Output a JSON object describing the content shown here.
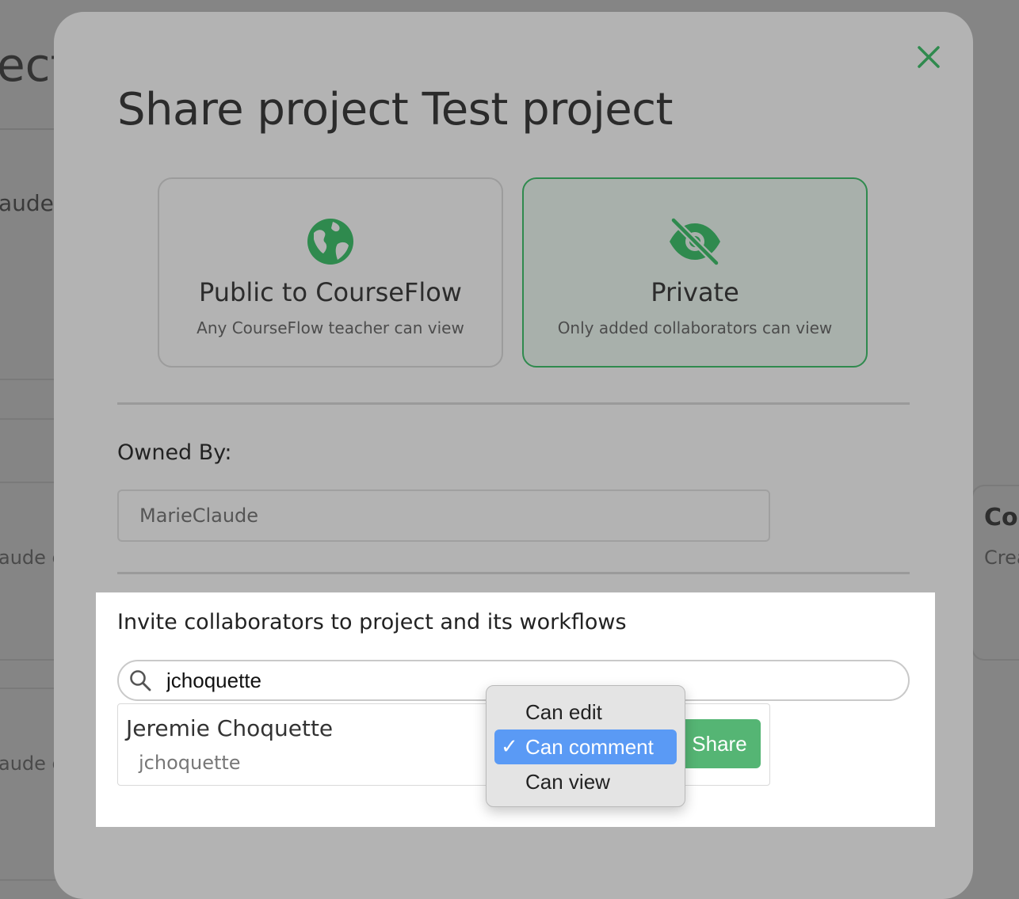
{
  "background": {
    "title_fragment": "ect",
    "name_fragment": "aude",
    "desc_fragment_1": "aude c",
    "desc_fragment_2": "aude c",
    "right_card_title": "Cou",
    "right_card_sub": "Crea"
  },
  "modal": {
    "title": "Share project Test project",
    "close_icon": "close-icon",
    "options": {
      "public": {
        "icon": "globe-icon",
        "title": "Public to CourseFlow",
        "subtitle": "Any CourseFlow teacher can view",
        "selected": false
      },
      "private": {
        "icon": "eye-slash-icon",
        "title": "Private",
        "subtitle": "Only added collaborators can view",
        "selected": true
      }
    },
    "owned_by_label": "Owned By:",
    "owner_value": "MarieClaude",
    "invite_heading": "Invite collaborators to project and its workflows",
    "search": {
      "icon": "search-icon",
      "value": "jchoquette"
    },
    "result": {
      "name": "Jeremie Choquette",
      "username": "jchoquette"
    },
    "permission_dropdown": {
      "options": [
        "Can edit",
        "Can comment",
        "Can view"
      ],
      "selected": "Can comment",
      "check_mark": "✓"
    },
    "share_label": "Share"
  },
  "colors": {
    "accent_green": "#2f8a4e",
    "share_button": "#55b574",
    "dropdown_selected": "#5a9af5"
  }
}
